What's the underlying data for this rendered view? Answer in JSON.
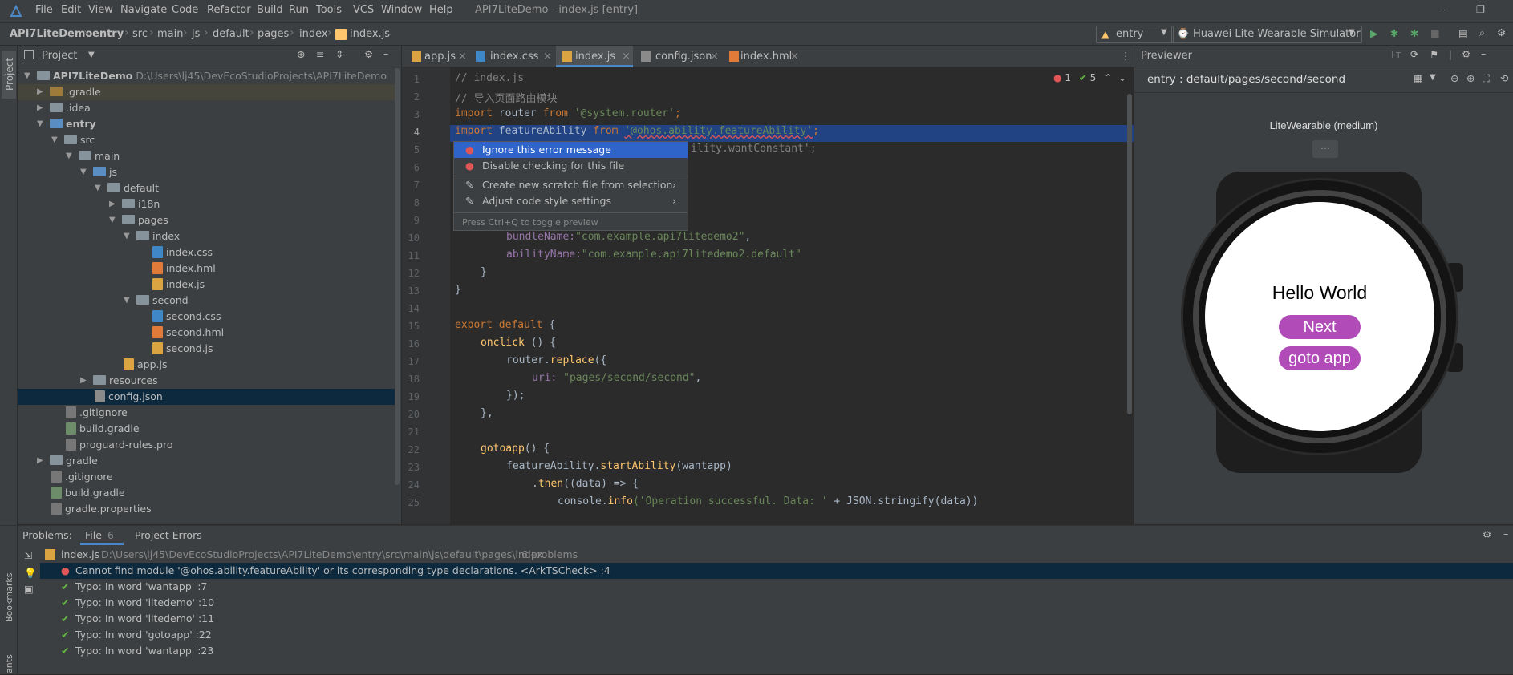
{
  "window": {
    "title": "API7LiteDemo - index.js [entry]",
    "menu": [
      "File",
      "Edit",
      "View",
      "Navigate",
      "Code",
      "Refactor",
      "Build",
      "Run",
      "Tools",
      "VCS",
      "Window",
      "Help"
    ]
  },
  "breadcrumb": [
    "API7LiteDemo",
    "entry",
    "src",
    "main",
    "js",
    "default",
    "pages",
    "index",
    "index.js"
  ],
  "toolbar": {
    "module": "entry",
    "device": "Huawei Lite Wearable Simulator"
  },
  "project": {
    "title": "Project",
    "root_name": "API7LiteDemo",
    "root_path": "D:\\Users\\lj45\\DevEcoStudioProjects\\API7LiteDemo",
    "items": [
      {
        "label": ".gradle"
      },
      {
        "label": ".idea"
      },
      {
        "label": "entry"
      },
      {
        "label": "src"
      },
      {
        "label": "main"
      },
      {
        "label": "js"
      },
      {
        "label": "default"
      },
      {
        "label": "i18n"
      },
      {
        "label": "pages"
      },
      {
        "label": "index"
      },
      {
        "label": "index.css"
      },
      {
        "label": "index.hml"
      },
      {
        "label": "index.js"
      },
      {
        "label": "second"
      },
      {
        "label": "second.css"
      },
      {
        "label": "second.hml"
      },
      {
        "label": "second.js"
      },
      {
        "label": "app.js"
      },
      {
        "label": "resources"
      },
      {
        "label": "config.json"
      },
      {
        "label": ".gitignore"
      },
      {
        "label": "build.gradle"
      },
      {
        "label": "proguard-rules.pro"
      },
      {
        "label": "gradle"
      },
      {
        "label": ".gitignore"
      },
      {
        "label": "build.gradle"
      },
      {
        "label": "gradle.properties"
      }
    ]
  },
  "tabs": [
    "app.js",
    "index.css",
    "index.js",
    "config.json",
    "index.hml"
  ],
  "inspection": {
    "errors": "1",
    "warnings": "5"
  },
  "code": {
    "lines": [
      "1",
      "2",
      "3",
      "4",
      "5",
      "6",
      "7",
      "8",
      "9",
      "10",
      "11",
      "12",
      "13",
      "14",
      "15",
      "16",
      "17",
      "18",
      "19",
      "20",
      "21",
      "22",
      "23",
      "24",
      "25"
    ],
    "l1": "// index.js",
    "l2": "// 导入页面路由模块",
    "l3_kw": "import",
    "l3_a": " router ",
    "l3_from": "from",
    "l3_str": "'@system.router'",
    "l3_end": ";",
    "l4_kw": "import",
    "l4_a": " featureAbility ",
    "l4_from": "from",
    "l4_str": "'@ohos.ability.featureAbility'",
    "l4_end": ";",
    "l5_tail": "ility.wantConstant';",
    "l10_key": "bundleName:",
    "l10_str": "\"com.example.api7litedemo2\"",
    "l10_end": ",",
    "l11_key": "abilityName:",
    "l11_str": "\"com.example.api7litedemo2.default\"",
    "l12": "}",
    "l13": "}",
    "l15_kw": "export default",
    "l15_end": " {",
    "l16_fn": "onclick",
    "l16_end": " () {",
    "l17_a": "router.",
    "l17_fn": "replace",
    "l17_end": "({",
    "l18_key": "uri:",
    "l18_str": "\"pages/second/second\"",
    "l18_end": ",",
    "l19": "});",
    "l20": "},",
    "l22_fn": "gotoapp",
    "l22_end": "() {",
    "l23_a": "featureAbility.",
    "l23_fn": "startAbility",
    "l23_p": "(wantapp)",
    "l24_a": ".",
    "l24_fn": "then",
    "l24_end": "((data) => {",
    "l25_a": "console.",
    "l25_fn": "info",
    "l25_str": "('Operation successful. Data: '",
    "l25_end": " + JSON.stringify(data))"
  },
  "popup": {
    "items": [
      "Ignore this error message",
      "Disable checking for this file",
      "Create new scratch file from selection",
      "Adjust code style settings"
    ],
    "hint": "Press Ctrl+Q to toggle preview"
  },
  "previewer": {
    "title": "Previewer",
    "path": "entry : default/pages/second/second",
    "device": "LiteWearable (medium)",
    "more": "···",
    "hello": "Hello World",
    "btn_next": "Next",
    "btn_goto": "goto app"
  },
  "problems": {
    "label": "Problems:",
    "tab_file": "File",
    "tab_file_count": "6",
    "tab_project": "Project Errors",
    "file_name": "index.js",
    "file_path": "D:\\Users\\lj45\\DevEcoStudioProjects\\API7LiteDemo\\entry\\src\\main\\js\\default\\pages\\index",
    "file_count": "6 problems",
    "error": "Cannot find module '@ohos.ability.featureAbility' or its corresponding type declarations. <ArkTSCheck> :4",
    "typos": [
      "Typo: In word 'wantapp' :7",
      "Typo: In word 'litedemo' :10",
      "Typo: In word 'litedemo' :11",
      "Typo: In word 'gotoapp' :22",
      "Typo: In word 'wantapp' :23"
    ]
  },
  "side": {
    "project": "Project",
    "bookmarks": "Bookmarks",
    "structure": "ants"
  },
  "colors": {
    "accent": "#4a88c7",
    "selection": "#0d293e",
    "watch_button": "#b04bb8",
    "error": "#e05555",
    "ok": "#62b543"
  }
}
